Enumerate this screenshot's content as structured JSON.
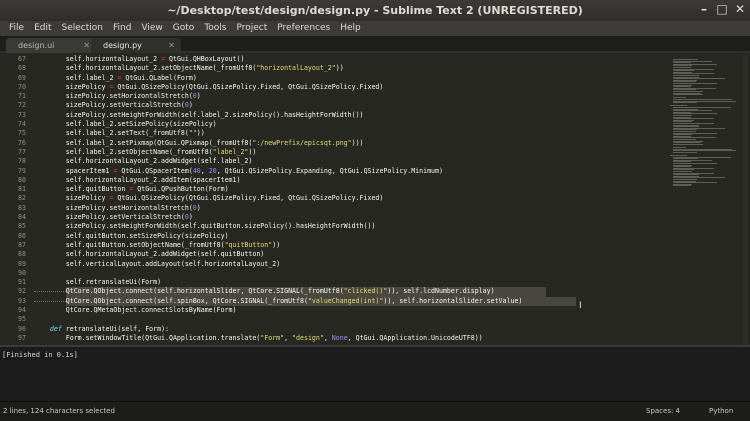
{
  "window": {
    "title": "~/Desktop/test/design/design.py - Sublime Text 2 (UNREGISTERED)",
    "controls": [
      "minimize-icon",
      "maximize-icon",
      "close-icon"
    ]
  },
  "menu": [
    "File",
    "Edit",
    "Selection",
    "Find",
    "View",
    "Goto",
    "Tools",
    "Project",
    "Preferences",
    "Help"
  ],
  "tabs": [
    {
      "label": "design.ui",
      "active": false
    },
    {
      "label": "design.py",
      "active": true
    }
  ],
  "editor": {
    "lines": [
      {
        "num": "67",
        "text": "        self.horizontalLayout_2 = QtGui.QHBoxLayout()"
      },
      {
        "num": "68",
        "text": "        self.horizontalLayout_2.setObjectName(_fromUtf8(\"horizontalLayout_2\"))"
      },
      {
        "num": "69",
        "text": "        self.label_2 = QtGui.QLabel(Form)"
      },
      {
        "num": "70",
        "text": "        sizePolicy = QtGui.QSizePolicy(QtGui.QSizePolicy.Fixed, QtGui.QSizePolicy.Fixed)"
      },
      {
        "num": "71",
        "text": "        sizePolicy.setHorizontalStretch(0)"
      },
      {
        "num": "72",
        "text": "        sizePolicy.setVerticalStretch(0)"
      },
      {
        "num": "73",
        "text": "        sizePolicy.setHeightForWidth(self.label_2.sizePolicy().hasHeightForWidth())"
      },
      {
        "num": "74",
        "text": "        self.label_2.setSizePolicy(sizePolicy)"
      },
      {
        "num": "75",
        "text": "        self.label_2.setText(_fromUtf8(\"\"))"
      },
      {
        "num": "76",
        "text": "        self.label_2.setPixmap(QtGui.QPixmap(_fromUtf8(\":/newPrefix/epicsqt.png\")))"
      },
      {
        "num": "77",
        "text": "        self.label_2.setObjectName(_fromUtf8(\"label_2\"))"
      },
      {
        "num": "78",
        "text": "        self.horizontalLayout_2.addWidget(self.label_2)"
      },
      {
        "num": "79",
        "text": "        spacerItem1 = QtGui.QSpacerItem(40, 20, QtGui.QSizePolicy.Expanding, QtGui.QSizePolicy.Minimum)"
      },
      {
        "num": "80",
        "text": "        self.horizontalLayout_2.addItem(spacerItem1)"
      },
      {
        "num": "81",
        "text": "        self.quitButton = QtGui.QPushButton(Form)"
      },
      {
        "num": "82",
        "text": "        sizePolicy = QtGui.QSizePolicy(QtGui.QSizePolicy.Fixed, QtGui.QSizePolicy.Fixed)"
      },
      {
        "num": "83",
        "text": "        sizePolicy.setHorizontalStretch(0)"
      },
      {
        "num": "84",
        "text": "        sizePolicy.setVerticalStretch(0)"
      },
      {
        "num": "85",
        "text": "        sizePolicy.setHeightForWidth(self.quitButton.sizePolicy().hasHeightForWidth())"
      },
      {
        "num": "86",
        "text": "        self.quitButton.setSizePolicy(sizePolicy)"
      },
      {
        "num": "87",
        "text": "        self.quitButton.setObjectName(_fromUtf8(\"quitButton\"))"
      },
      {
        "num": "88",
        "text": "        self.horizontalLayout_2.addWidget(self.quitButton)"
      },
      {
        "num": "89",
        "text": "        self.verticalLayout.addLayout(self.horizontalLayout_2)"
      },
      {
        "num": "90",
        "text": ""
      },
      {
        "num": "91",
        "text": "        self.retranslateUi(Form)"
      },
      {
        "num": "92",
        "text": "        QtCore.QObject.connect(self.horizontalSlider, QtCore.SIGNAL(_fromUtf8(\"clicked()\")), self.lcdNumber.display)"
      },
      {
        "num": "93",
        "text": "        QtCore.QObject.connect(self.spinBox, QtCore.SIGNAL(_fromUtf8(\"valueChanged(int)\")), self.horizontalSlider.setValue)"
      },
      {
        "num": "94",
        "text": "        QtCore.QMetaObject.connectSlotsByName(Form)"
      },
      {
        "num": "95",
        "text": ""
      },
      {
        "num": "96",
        "text": "    def retranslateUi(self, Form):"
      },
      {
        "num": "97",
        "text": "        Form.setWindowTitle(QtGui.QApplication.translate(\"Form\", \"design\", None, QtGui.QApplication.UnicodeUTF8))"
      }
    ]
  },
  "output": {
    "text": "[Finished in 0.1s]"
  },
  "status": {
    "selection": "2 lines, 124 characters selected",
    "indent": "Spaces: 4",
    "syntax": "Python"
  },
  "colors": {
    "background": "#272822",
    "keyword": "#f92672",
    "string": "#e6db74",
    "number": "#ae81ff",
    "function": "#a6e22e",
    "param": "#fd971f",
    "builtin": "#66d9ef",
    "selection": "#49483e"
  }
}
